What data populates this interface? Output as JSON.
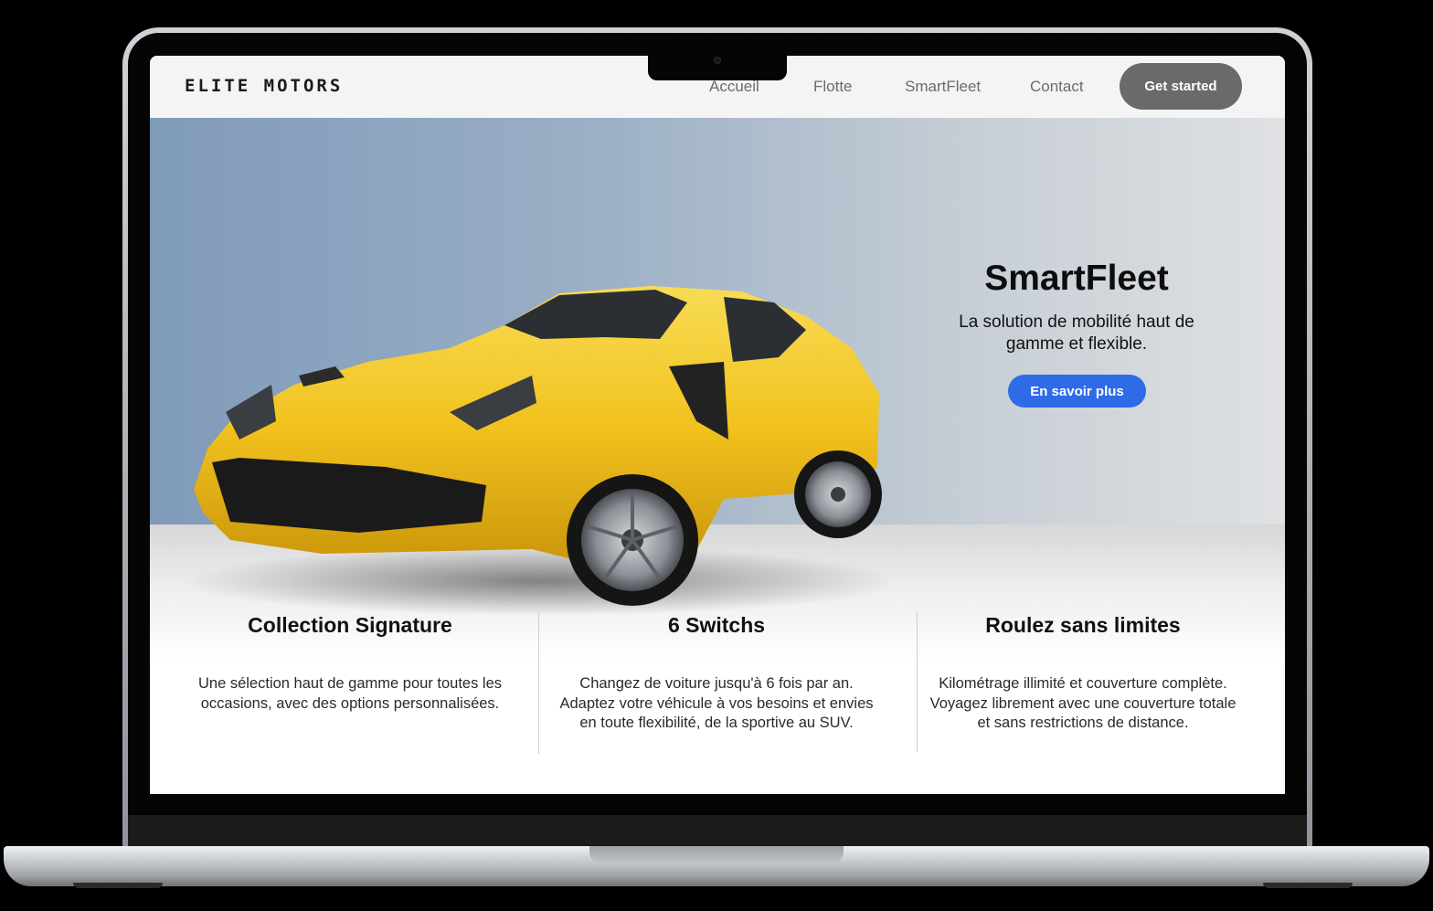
{
  "brand": {
    "logo": "ELITE MOTORS"
  },
  "nav": {
    "links": [
      "Accueil",
      "Flotte",
      "SmartFleet",
      "Contact"
    ],
    "cta": "Get started"
  },
  "hero": {
    "title": "SmartFleet",
    "subtitle": "La solution de mobilité haut de gamme et flexible.",
    "button": "En savoir plus",
    "image": "yellow-sports-car"
  },
  "features": [
    {
      "title": "Collection Signature",
      "text": "Une sélection haut de gamme pour toutes les occasions, avec des options personnalisées."
    },
    {
      "title": "6 Switchs",
      "text": "Changez de voiture jusqu'à 6 fois par an. Adaptez votre véhicule à vos besoins et envies en toute flexibilité, de la sportive au SUV."
    },
    {
      "title": "Roulez sans limites",
      "text": "Kilométrage illimité et couverture complète.\nVoyagez librement avec une couverture totale et sans restrictions de distance."
    }
  ],
  "colors": {
    "accent": "#2f6be6",
    "cta": "#6a6a6a",
    "car": "#f2c21e"
  }
}
